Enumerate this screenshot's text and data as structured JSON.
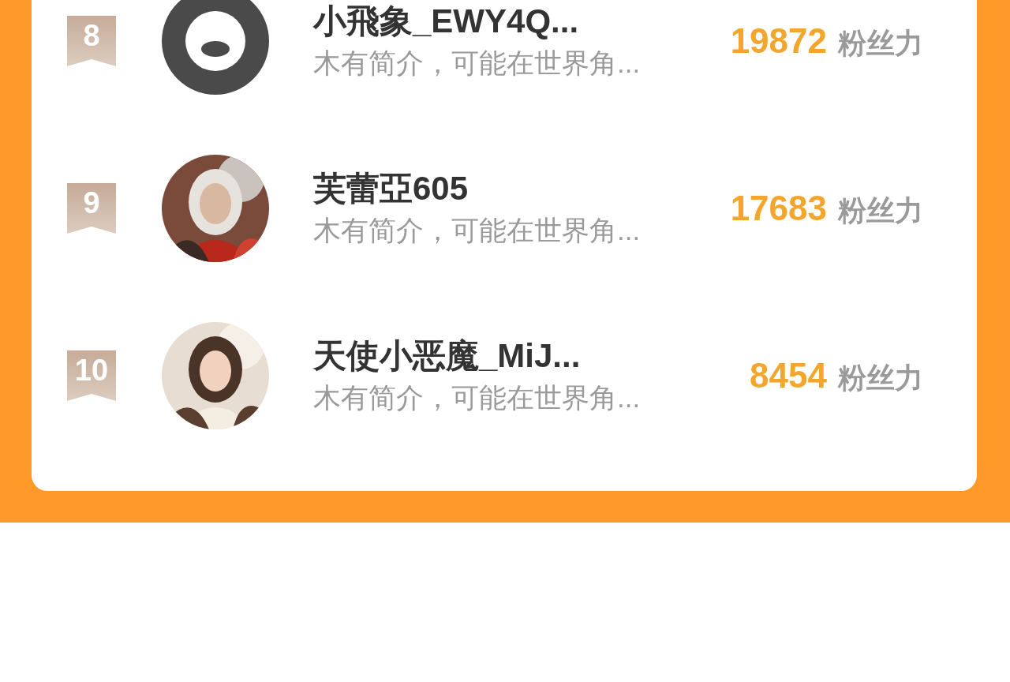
{
  "ranking": [
    {
      "rank": "8",
      "avatar": {
        "kind": "default"
      },
      "name": "小飛象_EWY4Q...",
      "bio": "木有简介，可能在世界角...",
      "fans": "19872",
      "fans_label": "粉丝力"
    },
    {
      "rank": "9",
      "name": "芙蕾亞605",
      "bio": "木有简介，可能在世界角...",
      "fans": "17683",
      "fans_label": "粉丝力"
    },
    {
      "rank": "10",
      "name": "天使小恶魔_MiJ...",
      "bio": "木有简介，可能在世界角...",
      "fans": "8454",
      "fans_label": "粉丝力"
    }
  ]
}
